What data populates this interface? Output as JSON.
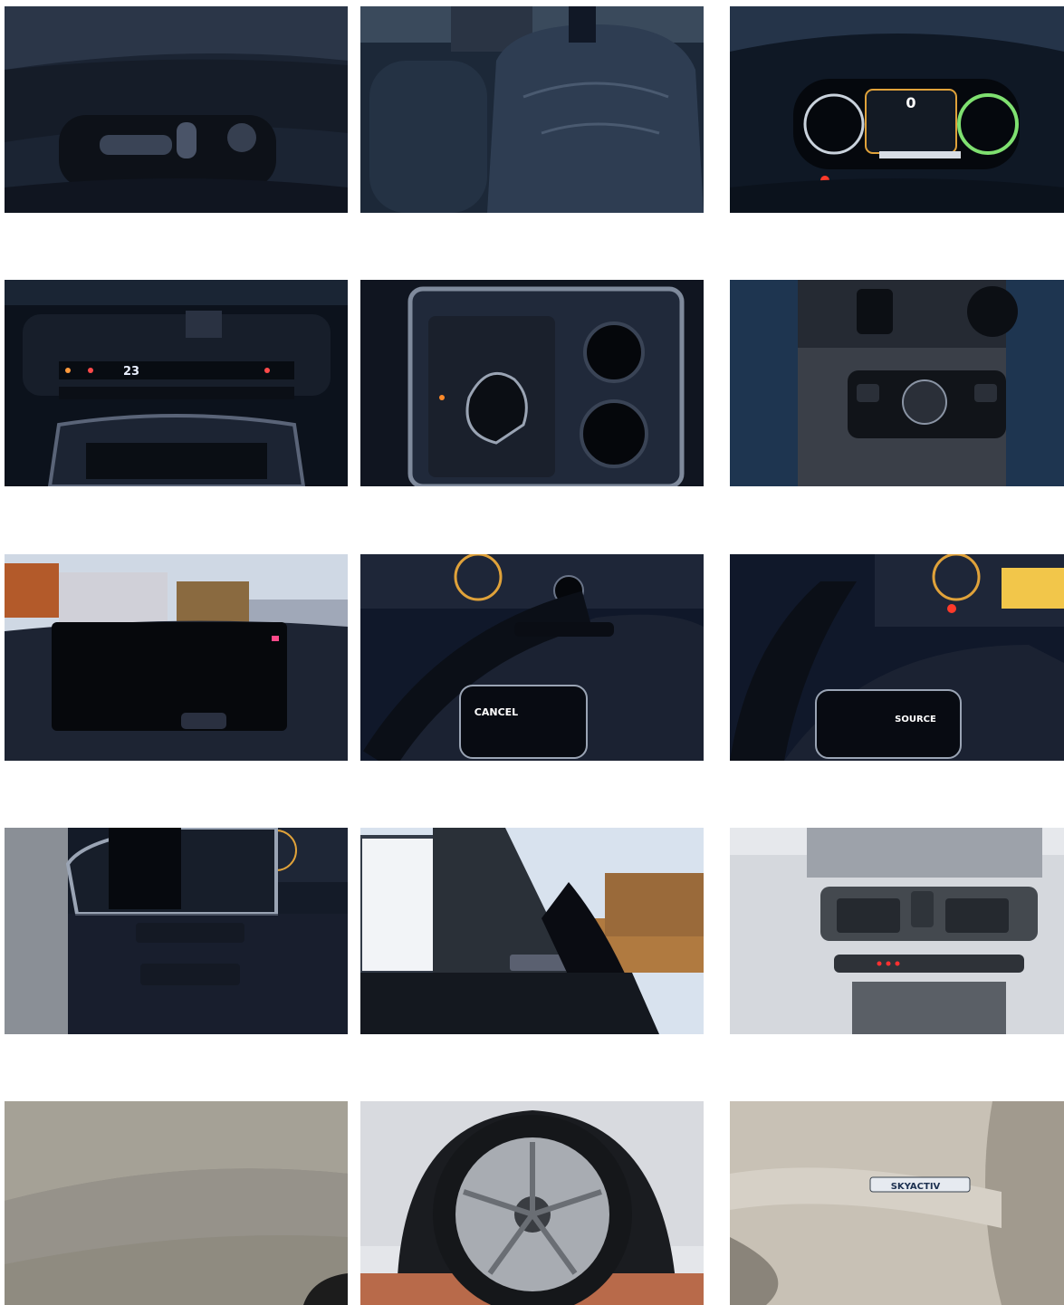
{
  "gallery": {
    "photos": [
      {
        "subject": "seat-adjustment-controls",
        "label": ""
      },
      {
        "subject": "leather-front-seats",
        "label": ""
      },
      {
        "subject": "digital-instrument-cluster",
        "label": "0"
      },
      {
        "subject": "climate-control-panel",
        "label": "23"
      },
      {
        "subject": "gear-selector-and-cupholders",
        "label": ""
      },
      {
        "subject": "commander-control-knob",
        "label": ""
      },
      {
        "subject": "infotainment-screen",
        "label": ""
      },
      {
        "subject": "steering-wheel-left-controls",
        "label": "CANCEL"
      },
      {
        "subject": "steering-wheel-right-controls",
        "label": "SOURCE"
      },
      {
        "subject": "driver-side-switch-panel",
        "label": ""
      },
      {
        "subject": "a-pillar-speaker",
        "label": ""
      },
      {
        "subject": "overhead-console",
        "label": ""
      },
      {
        "subject": "headliner",
        "label": ""
      },
      {
        "subject": "alloy-wheel",
        "label": ""
      },
      {
        "subject": "skyactiv-badge",
        "label": "SKYACTIV"
      }
    ]
  }
}
